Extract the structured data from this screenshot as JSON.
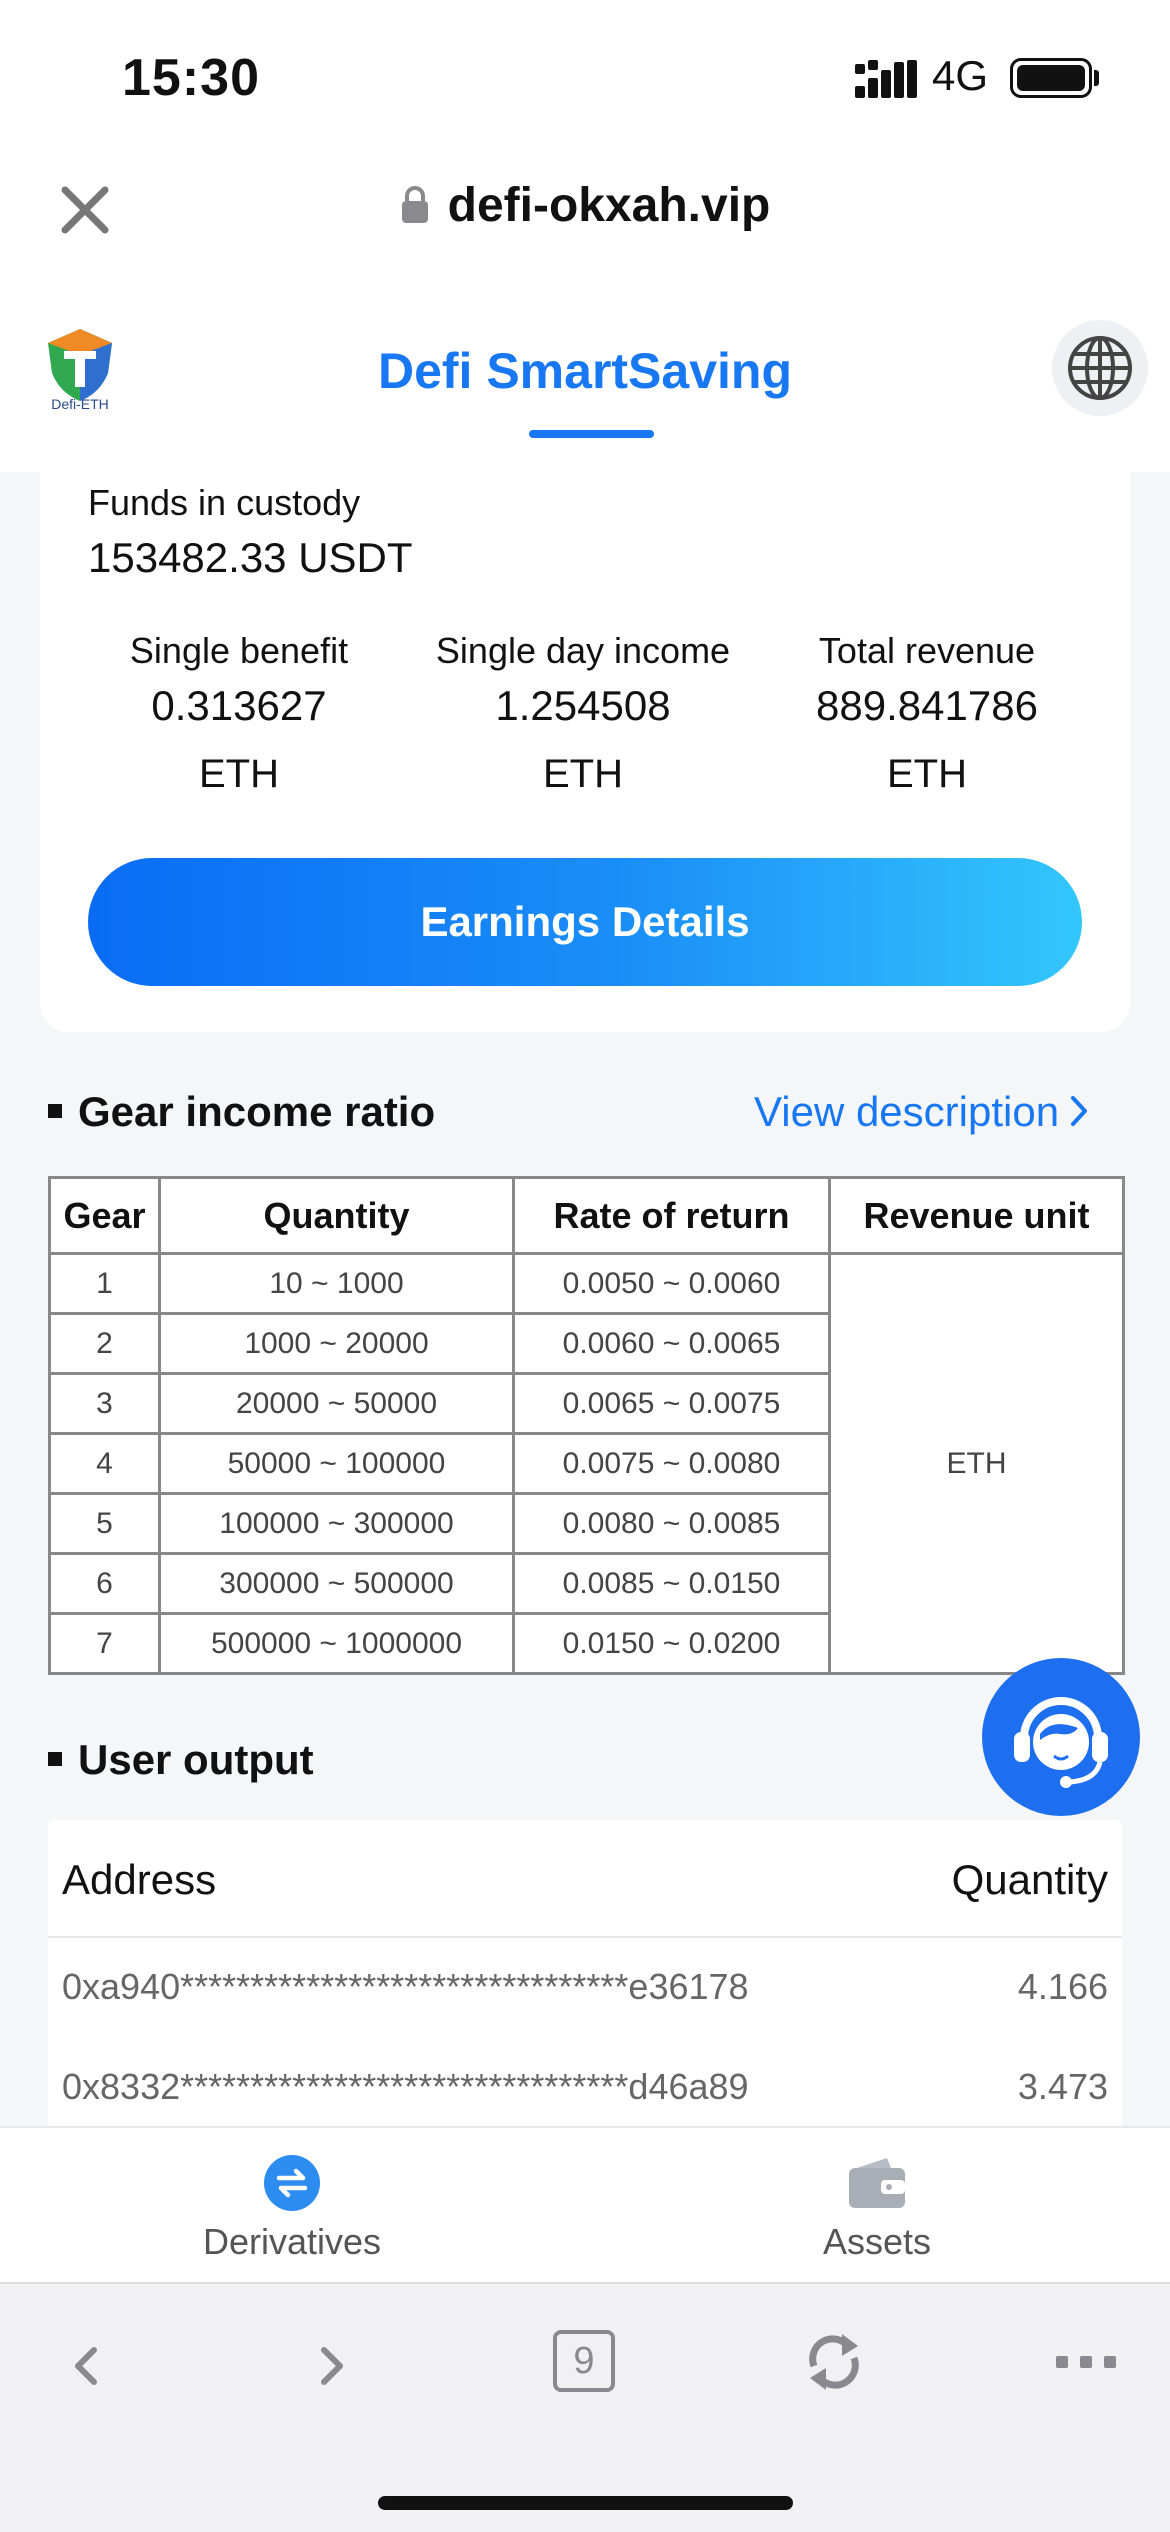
{
  "status_bar": {
    "time": "15:30",
    "network": "4G"
  },
  "browser": {
    "url": "defi-okxah.vip"
  },
  "header": {
    "title": "Defi SmartSaving",
    "logo_text": "Defi-ETH"
  },
  "card": {
    "custody_label": "Funds in custody",
    "custody_value": "153482.33 USDT",
    "stats": [
      {
        "label": "Single benefit",
        "value": "0.313627",
        "unit": "ETH"
      },
      {
        "label": "Single day income",
        "value": "1.254508",
        "unit": "ETH"
      },
      {
        "label": "Total revenue",
        "value": "889.841786",
        "unit": "ETH"
      }
    ],
    "button_label": "Earnings Details"
  },
  "gear_section": {
    "title": "Gear income ratio",
    "view_link": "View description",
    "columns": [
      "Gear",
      "Quantity",
      "Rate of return",
      "Revenue unit"
    ],
    "rows": [
      {
        "gear": "1",
        "quantity": "10 ~ 1000",
        "rate": "0.0050 ~ 0.0060"
      },
      {
        "gear": "2",
        "quantity": "1000 ~ 20000",
        "rate": "0.0060 ~ 0.0065"
      },
      {
        "gear": "3",
        "quantity": "20000 ~ 50000",
        "rate": "0.0065 ~ 0.0075"
      },
      {
        "gear": "4",
        "quantity": "50000 ~ 100000",
        "rate": "0.0075 ~ 0.0080"
      },
      {
        "gear": "5",
        "quantity": "100000 ~ 300000",
        "rate": "0.0080 ~ 0.0085"
      },
      {
        "gear": "6",
        "quantity": "300000 ~ 500000",
        "rate": "0.0085 ~ 0.0150"
      },
      {
        "gear": "7",
        "quantity": "500000 ~ 1000000",
        "rate": "0.0150 ~ 0.0200"
      }
    ],
    "revenue_unit": "ETH"
  },
  "user_output": {
    "title": "User output",
    "columns": [
      "Address",
      "Quantity"
    ],
    "rows": [
      {
        "address": "0xa940********************************e36178",
        "quantity": "4.166"
      },
      {
        "address": "0x8332********************************d46a89",
        "quantity": "3.473"
      }
    ]
  },
  "tabbar": {
    "tabs": [
      {
        "label": "Derivatives",
        "icon": "swap-icon"
      },
      {
        "label": "Assets",
        "icon": "wallet-icon"
      }
    ]
  },
  "toolbar": {
    "tab_count": "9"
  },
  "colors": {
    "accent": "#1877f2",
    "support": "#1e6ff0"
  }
}
